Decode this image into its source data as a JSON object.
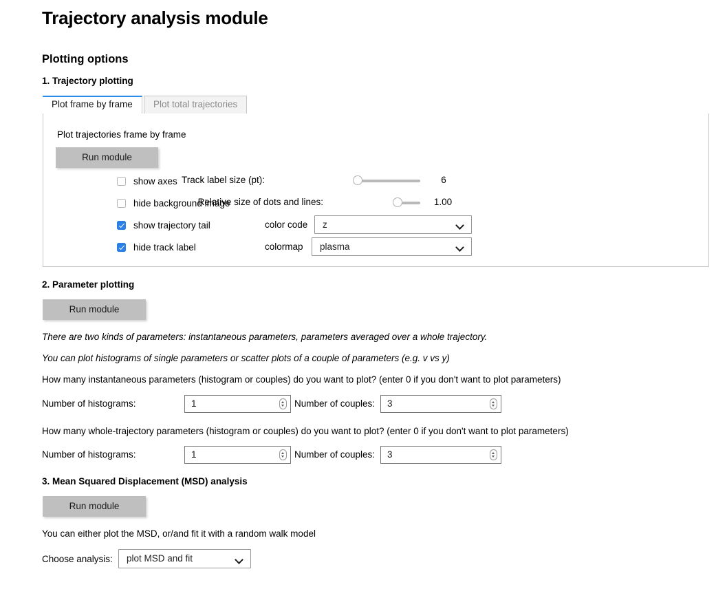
{
  "app": {
    "title": "Trajectory analysis module"
  },
  "plotting_options": {
    "heading": "Plotting options"
  },
  "section1": {
    "heading": "1. Trajectory plotting",
    "tabs": [
      {
        "label": "Plot frame by frame",
        "active": true
      },
      {
        "label": "Plot total trajectories",
        "active": false
      }
    ],
    "panel": {
      "caption": "Plot trajectories frame by frame",
      "run_button": "Run module",
      "checkboxes": [
        {
          "label": "show axes",
          "checked": false
        },
        {
          "label": "hide background image",
          "checked": false
        },
        {
          "label": "show trajectory tail",
          "checked": true
        },
        {
          "label": "hide track label",
          "checked": true
        }
      ],
      "sliders": [
        {
          "label": "Track label size (pt):",
          "value": "6"
        },
        {
          "label": "Relative size of dots and lines:",
          "value": "1.00"
        }
      ],
      "selects": [
        {
          "label": "color code",
          "value": "z"
        },
        {
          "label": "colormap",
          "value": "plasma"
        }
      ]
    }
  },
  "section2": {
    "heading": "2. Parameter plotting",
    "run_button": "Run module",
    "note_kinds": "There are two kinds of parameters: instantaneous parameters, parameters averaged over a whole trajectory.",
    "note_histograms": "You can plot histograms of single parameters or scatter plots of a couple of parameters (e.g. v vs y)",
    "instantaneous": {
      "question": "How many instantaneous parameters (histogram or couples) do you want to plot? (enter 0 if you don't want to plot parameters)",
      "histograms_label": "Number of histograms:",
      "histograms_value": "1",
      "couples_label": "Number of couples:",
      "couples_value": "3"
    },
    "whole_trajectory": {
      "question": "How many whole-trajectory parameters (histogram or couples) do you want to plot? (enter 0 if you don't want to plot parameters)",
      "histograms_label": "Number of histograms:",
      "histograms_value": "1",
      "couples_label": "Number of couples:",
      "couples_value": "3"
    }
  },
  "section3": {
    "heading": "3. Mean Squared Displacement (MSD) analysis",
    "run_button": "Run module",
    "note": "You can either plot the MSD, or/and fit it with a random walk model",
    "analysis_label": "Choose analysis:",
    "analysis_value": "plot MSD and fit"
  },
  "colors": {
    "accent_tab": "#2b8cea",
    "checkbox_checked": "#2b7fe8",
    "button_gray": "#bfbfbf",
    "border_gray": "#c6c6c6"
  }
}
